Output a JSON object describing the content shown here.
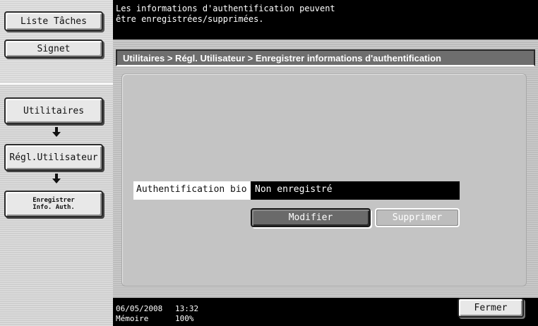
{
  "sidebar": {
    "job_list_label": "Liste Tâches",
    "bookmark_label": "Signet",
    "flow": [
      {
        "label": "Utilitaires"
      },
      {
        "label": "Régl.Utilisateur"
      },
      {
        "label": "Enregistrer\nInfo. Auth."
      }
    ]
  },
  "message": {
    "line1": "Les informations d'authentification peuvent",
    "line2": "être enregistrées/supprimées."
  },
  "breadcrumb": "Utilitaires > Régl. Utilisateur > Enregistrer informations d'authentification",
  "field": {
    "label": "Authentification bio",
    "value": "Non enregistré"
  },
  "buttons": {
    "modify": "Modifier",
    "delete": "Supprimer",
    "close": "Fermer"
  },
  "status": {
    "date": "06/05/2008",
    "time": "13:32",
    "memory_label": "Mémoire",
    "memory_value": "100%"
  },
  "colors": {
    "panel": "#bdbdbd",
    "title_bar": "#6e6e6e",
    "black_bar": "#000000",
    "button_active": "#6a6a6a"
  }
}
